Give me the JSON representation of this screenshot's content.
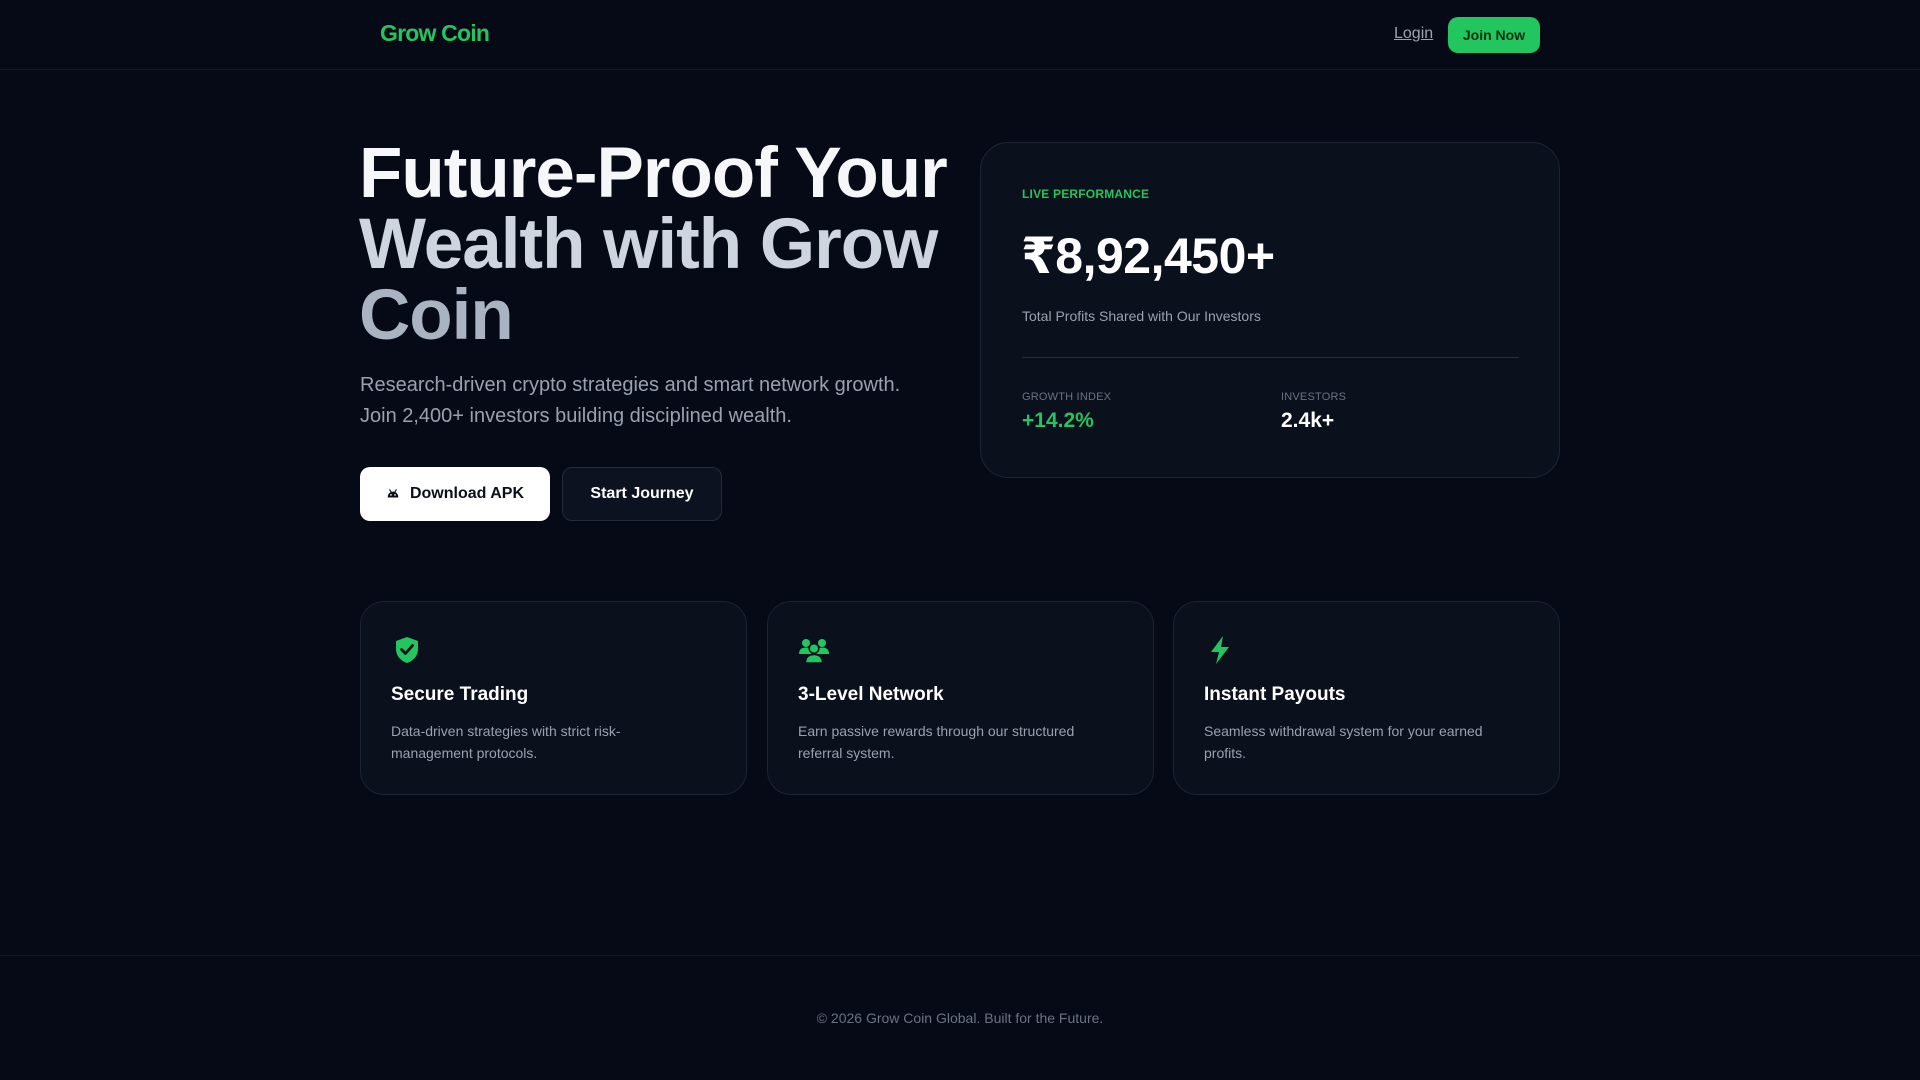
{
  "header": {
    "logo": "Grow Coin",
    "login_label": "Login",
    "join_label": "Join Now"
  },
  "hero": {
    "title_lines": [
      "Future-Proof Your",
      "Wealth with Grow",
      "Coin"
    ],
    "subtitle_lines": [
      "Research-driven crypto strategies and smart network growth.",
      "Join 2,400+ investors building disciplined wealth."
    ],
    "download_label": "Download APK",
    "download_icon": "android-icon",
    "journey_label": "Start Journey"
  },
  "performance": {
    "label": "LIVE PERFORMANCE",
    "amount": "₹8,92,450+",
    "description": "Total Profits Shared with Our Investors",
    "stats": [
      {
        "label": "GROWTH INDEX",
        "value": "+14.2%"
      },
      {
        "label": "INVESTORS",
        "value": "2.4k+"
      }
    ]
  },
  "features": [
    {
      "icon": "shield-check-icon",
      "title": "Secure Trading",
      "description": "Data-driven strategies with strict risk-management protocols."
    },
    {
      "icon": "users-icon",
      "title": "3-Level Network",
      "description": "Earn passive rewards through our structured referral system."
    },
    {
      "icon": "lightning-icon",
      "title": "Instant Payouts",
      "description": "Seamless withdrawal system for your earned profits."
    }
  ],
  "footer": {
    "text": "© 2026 Grow Coin Global. Built for the Future."
  },
  "colors": {
    "background": "#060a16",
    "accent": "#22c55e",
    "card": "#0b101d"
  }
}
